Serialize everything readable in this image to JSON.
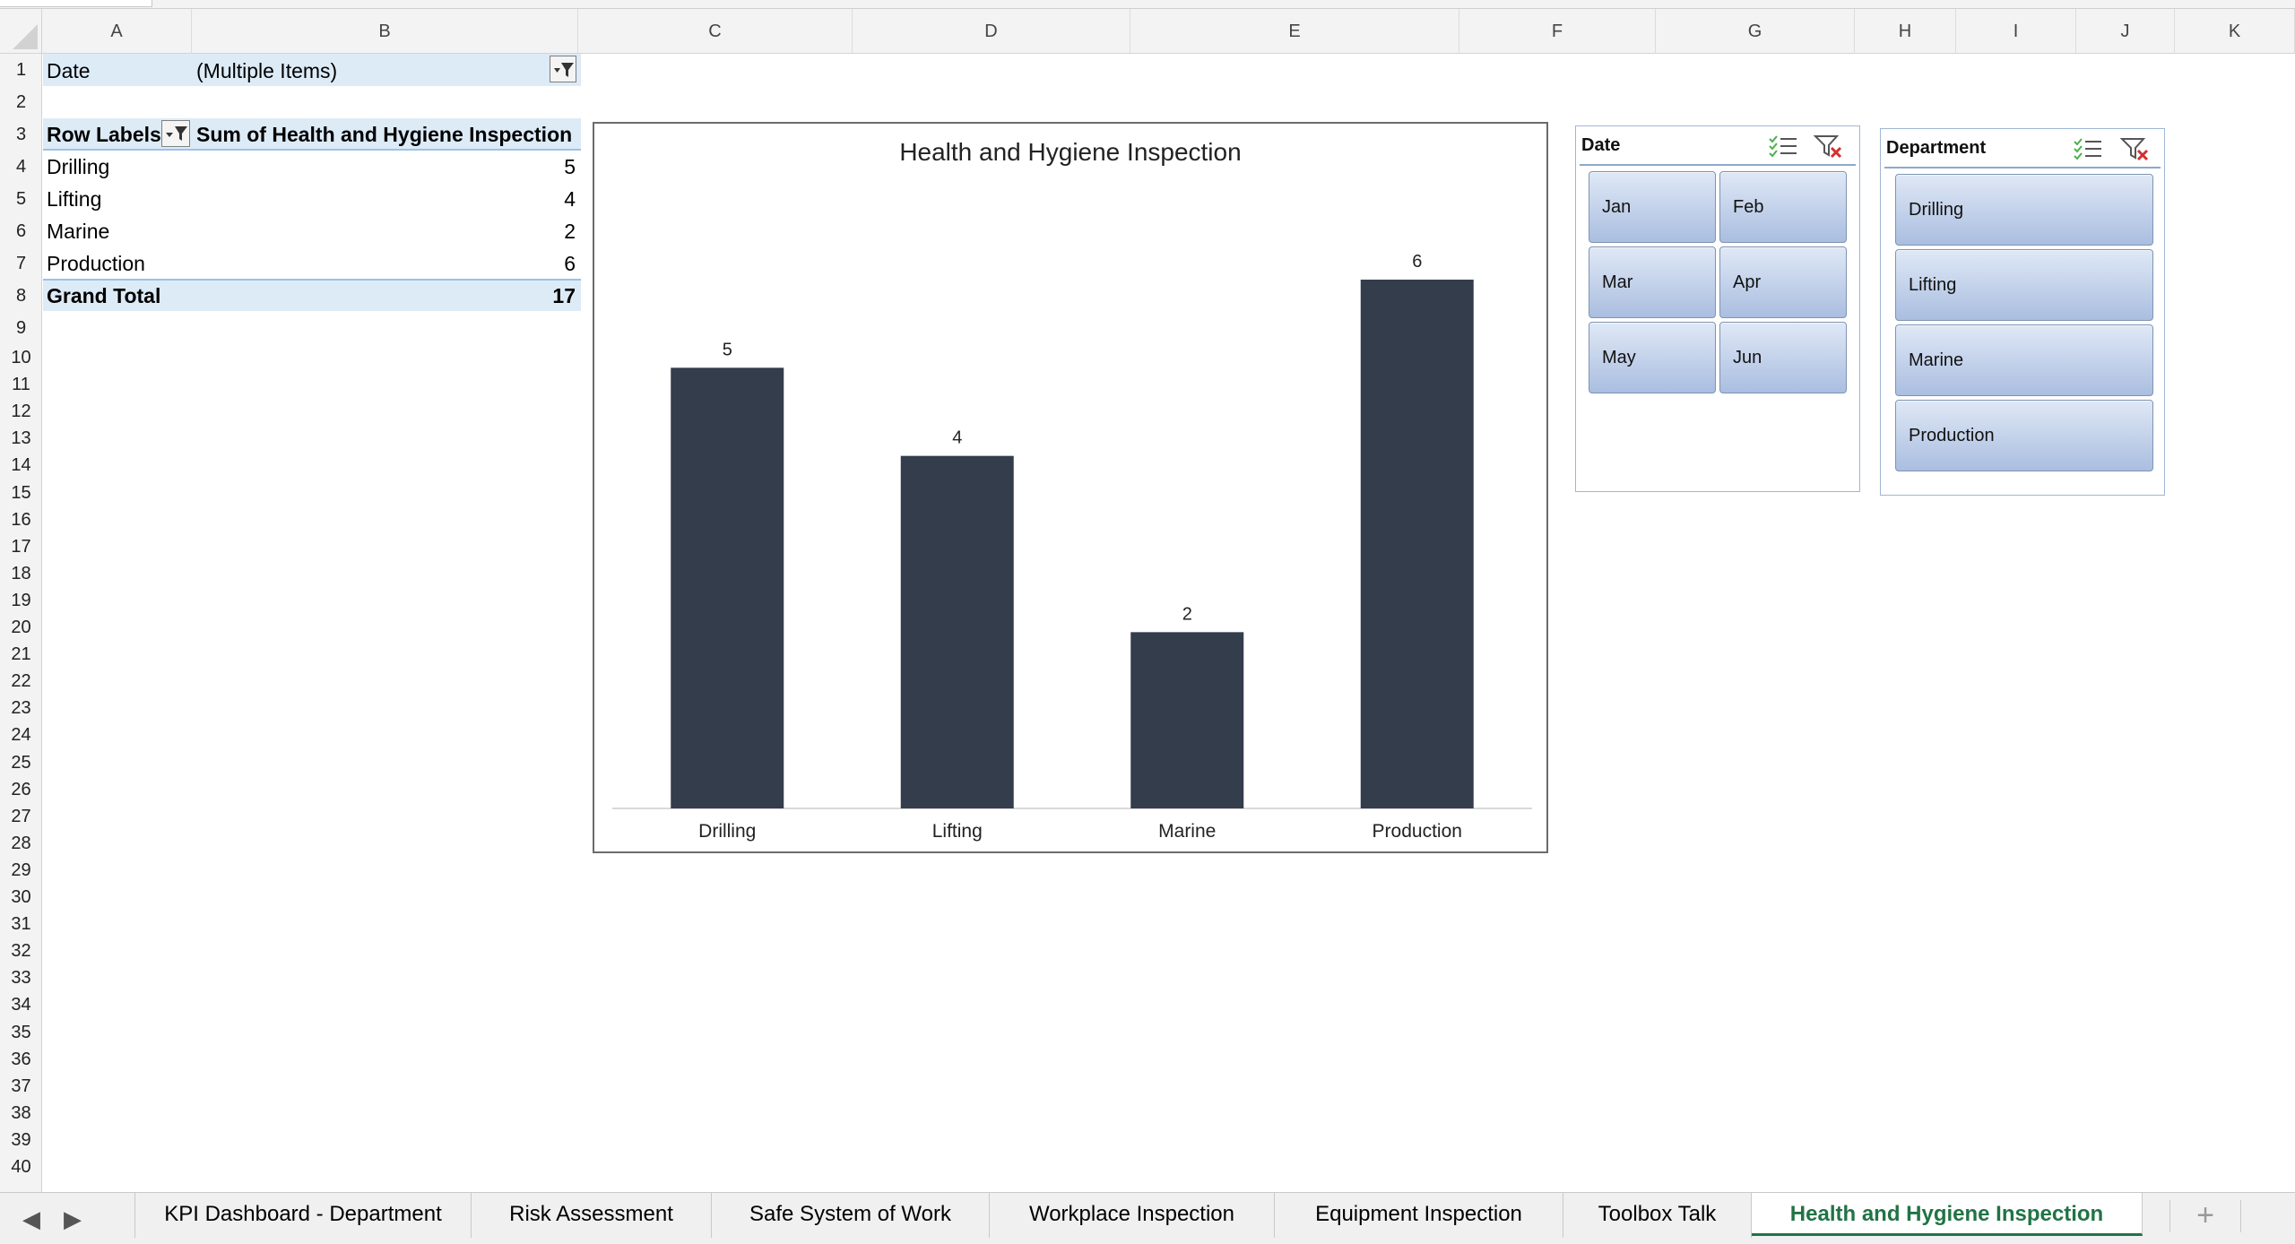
{
  "columns": [
    "A",
    "B",
    "C",
    "D",
    "E",
    "F",
    "G",
    "H",
    "I",
    "J",
    "K"
  ],
  "rows": [
    "1",
    "2",
    "3",
    "4",
    "5",
    "6",
    "7",
    "8",
    "9",
    "10",
    "11",
    "12",
    "13",
    "14",
    "15",
    "16",
    "17",
    "18",
    "19",
    "20",
    "21",
    "22",
    "23",
    "24",
    "25",
    "26",
    "27",
    "28",
    "29",
    "30",
    "31",
    "32",
    "33",
    "34",
    "35",
    "36",
    "37",
    "38",
    "39",
    "40"
  ],
  "pivot": {
    "filter_label": "Date",
    "filter_value": "(Multiple Items)",
    "row_labels_header": "Row Labels",
    "value_header": "Sum of Health and Hygiene Inspection",
    "rows": [
      {
        "label": "Drilling",
        "value": "5"
      },
      {
        "label": "Lifting",
        "value": "4"
      },
      {
        "label": "Marine",
        "value": "2"
      },
      {
        "label": "Production",
        "value": "6"
      }
    ],
    "grand_total_label": "Grand Total",
    "grand_total_value": "17"
  },
  "chart_data": {
    "type": "bar",
    "title": "Health and Hygiene Inspection",
    "categories": [
      "Drilling",
      "Lifting",
      "Marine",
      "Production"
    ],
    "values": [
      5,
      4,
      2,
      6
    ],
    "data_labels": [
      "5",
      "4",
      "2",
      "6"
    ],
    "xlabel": "",
    "ylabel": "",
    "ylim": [
      0,
      6
    ],
    "bar_color": "#333d4c",
    "grid": false,
    "legend": "none"
  },
  "slicers": {
    "date": {
      "title": "Date",
      "items": [
        "Jan",
        "Feb",
        "Mar",
        "Apr",
        "May",
        "Jun"
      ]
    },
    "department": {
      "title": "Department",
      "items": [
        "Drilling",
        "Lifting",
        "Marine",
        "Production"
      ]
    }
  },
  "sheet_tabs": {
    "items": [
      "KPI Dashboard - Department",
      "Risk Assessment",
      "Safe System of Work",
      "Workplace Inspection",
      "Equipment Inspection",
      "Toolbox Talk",
      "Health and Hygiene Inspection"
    ],
    "active": "Health and Hygiene Inspection",
    "add_label": "+"
  },
  "colors": {
    "accent_green": "#217346",
    "pivot_band": "#ddebf7",
    "slicer_button": "#b9cbe6"
  }
}
